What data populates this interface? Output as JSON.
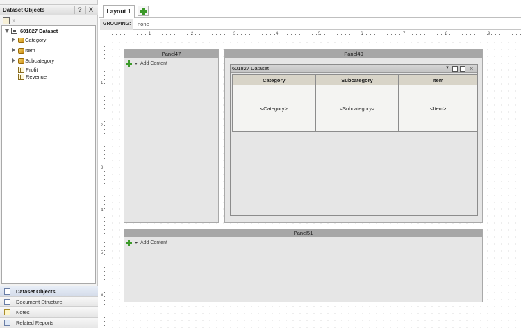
{
  "left_panel": {
    "title": "Dataset Objects",
    "help_btn": "?",
    "close_btn": "X",
    "tree": {
      "dataset": "601827 Dataset",
      "attributes": [
        "Category",
        "Item",
        "Subcategory"
      ],
      "metrics": [
        "Profit",
        "Revenue"
      ]
    },
    "bottom_nav": [
      {
        "label": "Dataset Objects",
        "icon": "dataset-objects-icon",
        "active": true
      },
      {
        "label": "Document Structure",
        "icon": "document-structure-icon",
        "active": false
      },
      {
        "label": "Notes",
        "icon": "notes-icon",
        "active": false
      },
      {
        "label": "Related Reports",
        "icon": "related-reports-icon",
        "active": false
      }
    ]
  },
  "layout_tabs": {
    "active_tab": "Layout 1"
  },
  "grouping": {
    "label": "GROUPING:",
    "value": "none"
  },
  "ruler": {
    "top_marks": [
      "1",
      "2",
      "3",
      "4",
      "5",
      "6",
      "7",
      "8",
      "9"
    ],
    "left_marks": [
      "1",
      "2",
      "3",
      "4",
      "5",
      "6"
    ]
  },
  "panels": {
    "panel47": {
      "title": "Panel47",
      "add_content": "Add Content"
    },
    "panel49": {
      "title": "Panel49"
    },
    "panel51": {
      "title": "Panel51",
      "add_content": "Add Content"
    }
  },
  "grid": {
    "title": "601827 Dataset",
    "columns": [
      "Category",
      "Subcategory",
      "Item"
    ],
    "cells": [
      "<Category>",
      "<Subcategory>",
      "<Item>"
    ]
  },
  "colors": {
    "panel_title_bg": "#a7a7a7",
    "panel_bg": "#e6e6e6",
    "add_green": "#3c9a2a"
  }
}
